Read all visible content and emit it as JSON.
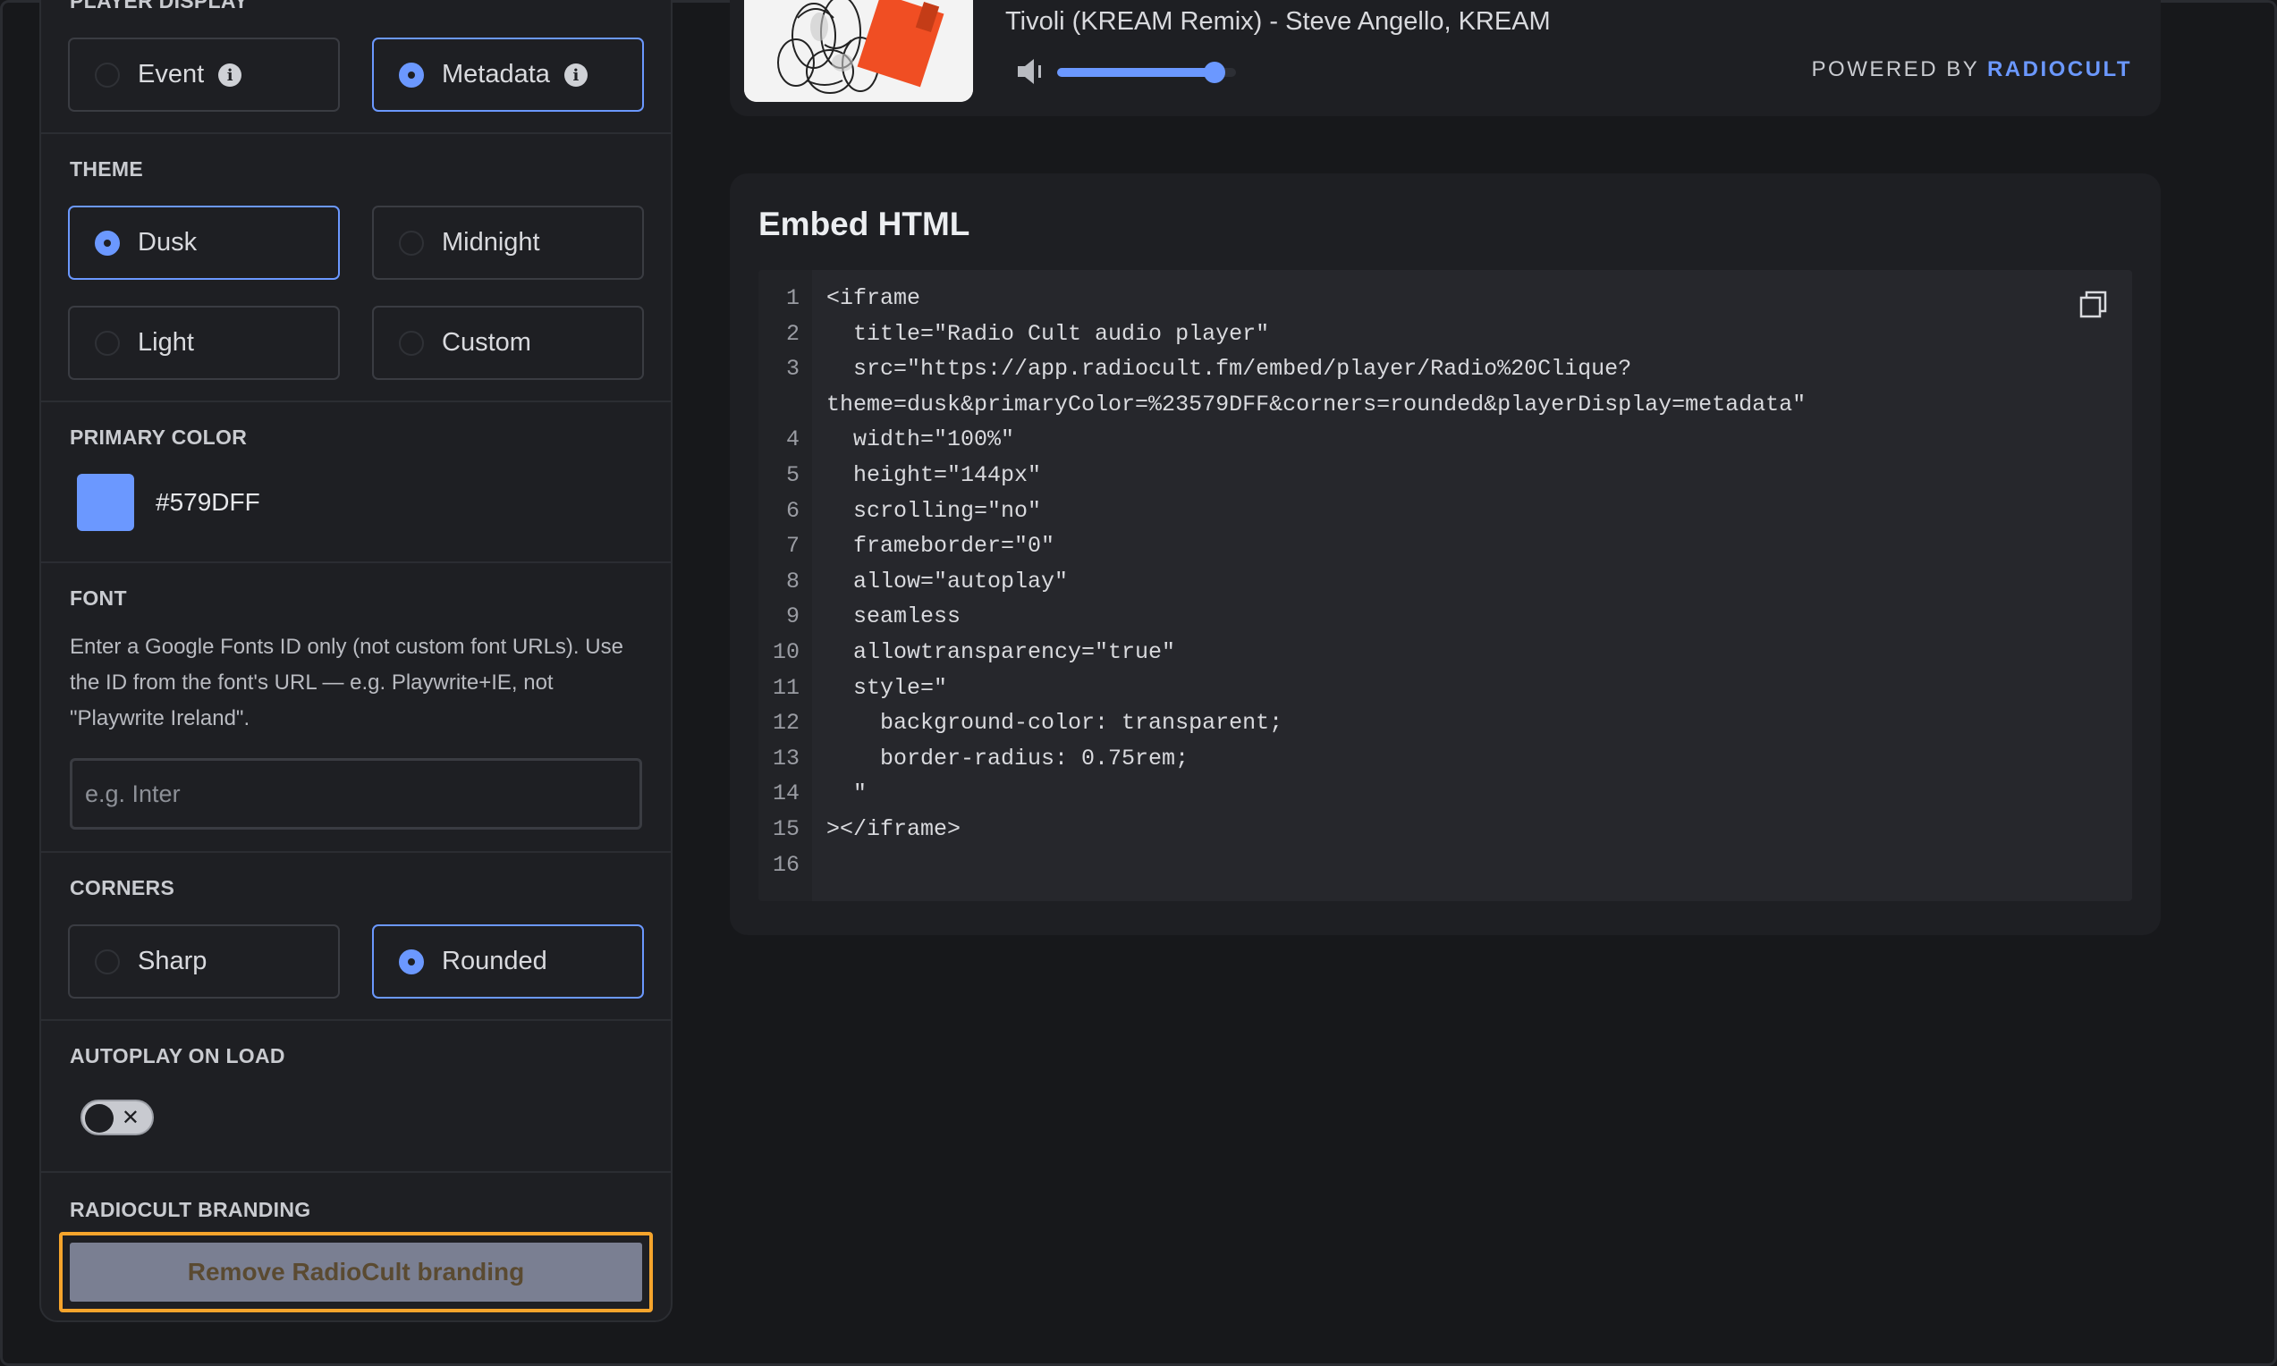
{
  "sidebar": {
    "player_display": {
      "title": "PLAYER DISPLAY",
      "options": [
        {
          "label": "Event",
          "selected": false,
          "has_info": true
        },
        {
          "label": "Metadata",
          "selected": true,
          "has_info": true
        }
      ]
    },
    "theme": {
      "title": "THEME",
      "options": [
        {
          "label": "Dusk",
          "selected": true
        },
        {
          "label": "Midnight",
          "selected": false
        },
        {
          "label": "Light",
          "selected": false
        },
        {
          "label": "Custom",
          "selected": false
        }
      ]
    },
    "primary_color": {
      "title": "PRIMARY COLOR",
      "value": "#579DFF",
      "swatch_color": "#6b98ff"
    },
    "font": {
      "title": "FONT",
      "help_line1": "Enter a Google Fonts ID only (not custom font URLs). Use",
      "help_line2": "the ID from the font's URL — e.g. Playwrite+IE, not",
      "help_line3": "\"Playwrite Ireland\".",
      "placeholder": "e.g. Inter",
      "value": ""
    },
    "corners": {
      "title": "CORNERS",
      "options": [
        {
          "label": "Sharp",
          "selected": false
        },
        {
          "label": "Rounded",
          "selected": true
        }
      ]
    },
    "autoplay": {
      "title": "AUTOPLAY ON LOAD",
      "enabled": false,
      "toggle_glyph": "✕"
    },
    "branding": {
      "title": "RADIOCULT BRANDING",
      "button_label": "Remove RadioCult branding"
    }
  },
  "player": {
    "track": "Tivoli (KREAM Remix) - Steve Angello, KREAM",
    "volume": 0.85,
    "powered_by": "POWERED BY ",
    "brand": "RADIOCULT",
    "icons": [
      "album-art",
      "speaker-icon"
    ]
  },
  "embed": {
    "title": "Embed HTML",
    "lines": [
      {
        "n": "1",
        "text": "<iframe"
      },
      {
        "n": "2",
        "text": "  title=\"Radio Cult audio player\""
      },
      {
        "n": "3",
        "text": "  src=\"https://app.radiocult.fm/embed/player/Radio%20Clique?"
      },
      {
        "n": "",
        "text": "theme=dusk&primaryColor=%23579DFF&corners=rounded&playerDisplay=metadata\""
      },
      {
        "n": "4",
        "text": "  width=\"100%\""
      },
      {
        "n": "5",
        "text": "  height=\"144px\""
      },
      {
        "n": "6",
        "text": "  scrolling=\"no\""
      },
      {
        "n": "7",
        "text": "  frameborder=\"0\""
      },
      {
        "n": "8",
        "text": "  allow=\"autoplay\""
      },
      {
        "n": "9",
        "text": "  seamless"
      },
      {
        "n": "10",
        "text": "  allowtransparency=\"true\""
      },
      {
        "n": "11",
        "text": "  style=\""
      },
      {
        "n": "12",
        "text": "    background-color: transparent;"
      },
      {
        "n": "13",
        "text": "    border-radius: 0.75rem;"
      },
      {
        "n": "14",
        "text": "  \""
      },
      {
        "n": "15",
        "text": "></iframe>"
      },
      {
        "n": "16",
        "text": ""
      }
    ],
    "copy_icon": "copy-icon"
  },
  "colors": {
    "accent": "#6b98ff",
    "background": "#17181b",
    "panel": "#1e1f23",
    "highlight": "#f5a42c"
  }
}
